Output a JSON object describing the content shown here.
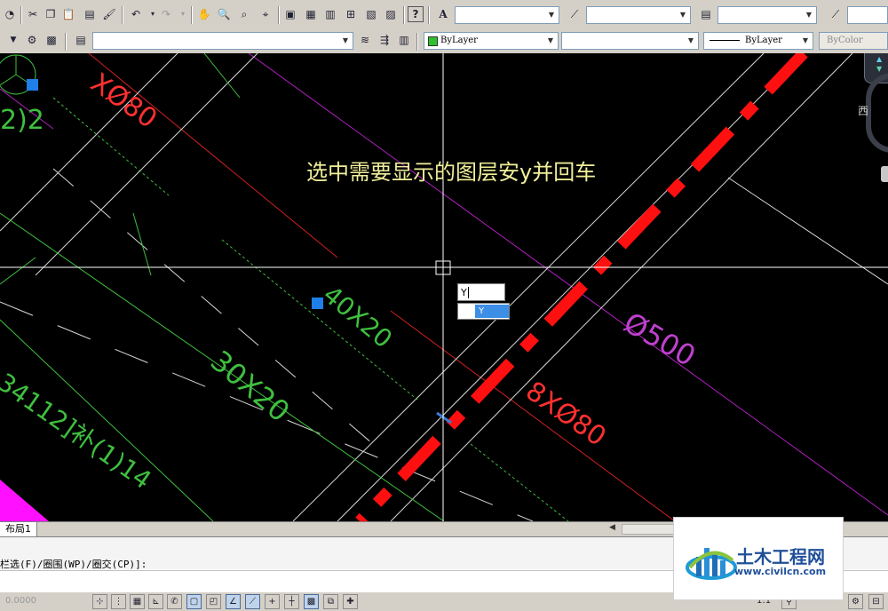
{
  "toolbar_top": {
    "icons": [
      "open-icon",
      "cut-icon",
      "copy-icon",
      "paste-icon",
      "match-icon",
      "brush-icon",
      "undo-icon",
      "redo-icon",
      "pan-icon",
      "zoom-realtime-icon",
      "zoom-window-icon",
      "zoom-previous-icon",
      "properties-icon",
      "design-center-icon",
      "tool-palettes-icon",
      "sheet-set-icon",
      "markup-icon",
      "calculator-icon",
      "help-icon"
    ],
    "text_style_value": "",
    "dim_style_value": "",
    "table_style_value": ""
  },
  "toolbar_layers": {
    "layer_value": "",
    "color_value": "ByLayer",
    "linetype_value": "",
    "lineweight_value": "ByLayer",
    "plotstyle_value": "ByColor"
  },
  "canvas": {
    "annotation": "选中需要显示的图层安y并回车",
    "labels": {
      "rebar_top": "XØ80",
      "phi500": "Ø500",
      "rebar_8x80": "8XØ80",
      "dim_40x20": "40X20",
      "dim_30x20": "30X20",
      "side_text": "34112]补(1)14",
      "left_text": "2)2"
    },
    "viewcube_label": "西",
    "input_value": "Y",
    "autocomplete_option": "Y",
    "colors": {
      "bg": "#000000",
      "red_line": "#ff1010",
      "green": "#3fbf3f",
      "purple": "#b020c0",
      "white": "#ffffff",
      "annotation": "#f0ef9a",
      "label_red": "#ff3030",
      "label_green": "#3fd03f",
      "label_purple": "#c040d0"
    }
  },
  "layout_tabs": {
    "active_tab": "布局1"
  },
  "command_line": {
    "prompt": "栏选(F)/圈围(WP)/圈交(CP)]:",
    "coords": "0.0000"
  },
  "status_bar": {
    "scale": "1:1"
  },
  "watermark": {
    "title": "土木工程网",
    "url": "www.civilcn.com"
  }
}
